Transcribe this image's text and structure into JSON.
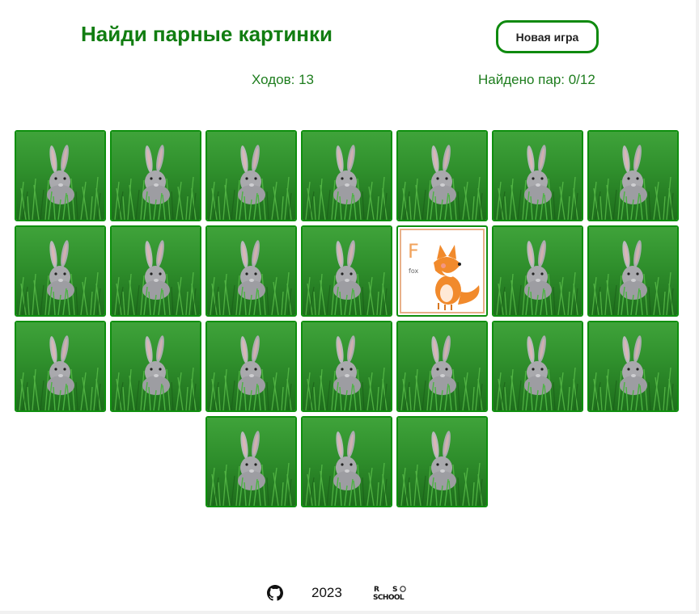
{
  "header": {
    "title": "Найди парные картинки",
    "new_game_label": "Новая игра"
  },
  "stats": {
    "moves_text": "Ходов: 13",
    "pairs_text": "Найдено пар: 0/12"
  },
  "colors": {
    "accent_green": "#117d11",
    "card_border": "#0e8f0e",
    "fox_orange": "#f18a2c"
  },
  "board": {
    "cards": [
      {
        "face": "back",
        "icon": "rabbit-in-grass"
      },
      {
        "face": "back",
        "icon": "rabbit-in-grass"
      },
      {
        "face": "back",
        "icon": "rabbit-in-grass"
      },
      {
        "face": "back",
        "icon": "rabbit-in-grass"
      },
      {
        "face": "back",
        "icon": "rabbit-in-grass"
      },
      {
        "face": "back",
        "icon": "rabbit-in-grass"
      },
      {
        "face": "back",
        "icon": "rabbit-in-grass"
      },
      {
        "face": "back",
        "icon": "rabbit-in-grass"
      },
      {
        "face": "back",
        "icon": "rabbit-in-grass"
      },
      {
        "face": "back",
        "icon": "rabbit-in-grass"
      },
      {
        "face": "back",
        "icon": "rabbit-in-grass"
      },
      {
        "face": "open",
        "icon": "fox",
        "letter": "F",
        "word": "fox"
      },
      {
        "face": "back",
        "icon": "rabbit-in-grass"
      },
      {
        "face": "back",
        "icon": "rabbit-in-grass"
      },
      {
        "face": "back",
        "icon": "rabbit-in-grass"
      },
      {
        "face": "back",
        "icon": "rabbit-in-grass"
      },
      {
        "face": "back",
        "icon": "rabbit-in-grass"
      },
      {
        "face": "back",
        "icon": "rabbit-in-grass"
      },
      {
        "face": "back",
        "icon": "rabbit-in-grass"
      },
      {
        "face": "back",
        "icon": "rabbit-in-grass"
      },
      {
        "face": "back",
        "icon": "rabbit-in-grass"
      },
      {
        "face": "back",
        "icon": "rabbit-in-grass"
      },
      {
        "face": "back",
        "icon": "rabbit-in-grass"
      },
      {
        "face": "back",
        "icon": "rabbit-in-grass"
      }
    ]
  },
  "footer": {
    "github_icon": "github-icon",
    "year": "2023",
    "logo_text": "RS SCHOOL"
  }
}
